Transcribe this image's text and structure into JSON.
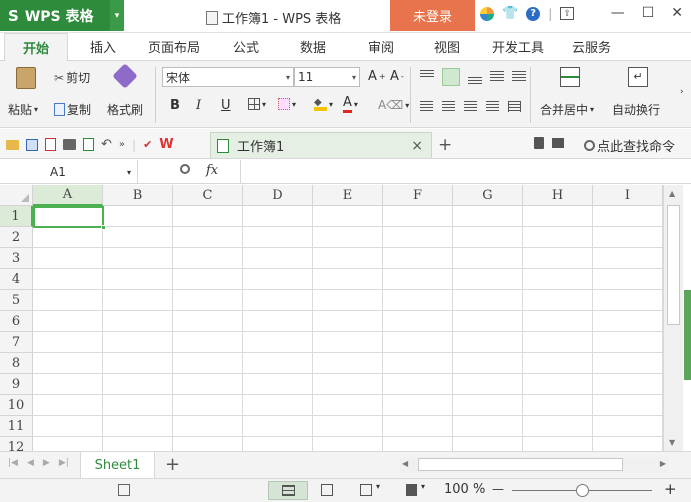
{
  "app": {
    "logo_s": "S",
    "logo_text": "WPS 表格",
    "caret": "▾",
    "title": "工作簿1 - WPS 表格",
    "login": "未登录"
  },
  "window_controls": {
    "minimize": "—",
    "maximize": "☐",
    "close": "✕"
  },
  "menu": {
    "tabs": [
      "开始",
      "插入",
      "页面布局",
      "公式",
      "数据",
      "审阅",
      "视图",
      "开发工具",
      "云服务"
    ]
  },
  "ribbon": {
    "paste": "粘贴",
    "cut": "剪切",
    "copy": "复制",
    "format_painter": "格式刷",
    "font_name": "宋体",
    "font_size": "11",
    "bold": "B",
    "italic": "I",
    "underline": "U",
    "grow": "A",
    "shrink": "A",
    "merge_center": "合并居中",
    "auto_wrap": "自动换行"
  },
  "doc_tab": {
    "name": "工作簿1",
    "close": "×",
    "add": "+"
  },
  "search": {
    "label": "点此查找命令"
  },
  "formula": {
    "cell_ref": "A1",
    "fx": "fx"
  },
  "columns": [
    "A",
    "B",
    "C",
    "D",
    "E",
    "F",
    "G",
    "H",
    "I"
  ],
  "rows": [
    "1",
    "2",
    "3",
    "4",
    "5",
    "6",
    "7",
    "8",
    "9",
    "10",
    "11",
    "12"
  ],
  "sheet": {
    "name": "Sheet1",
    "add": "+"
  },
  "status": {
    "zoom": "100 %",
    "minus": "—",
    "plus": "+"
  },
  "colors": {
    "brand": "#2e8b3c",
    "login": "#e8744d",
    "selection": "#4caf50"
  }
}
